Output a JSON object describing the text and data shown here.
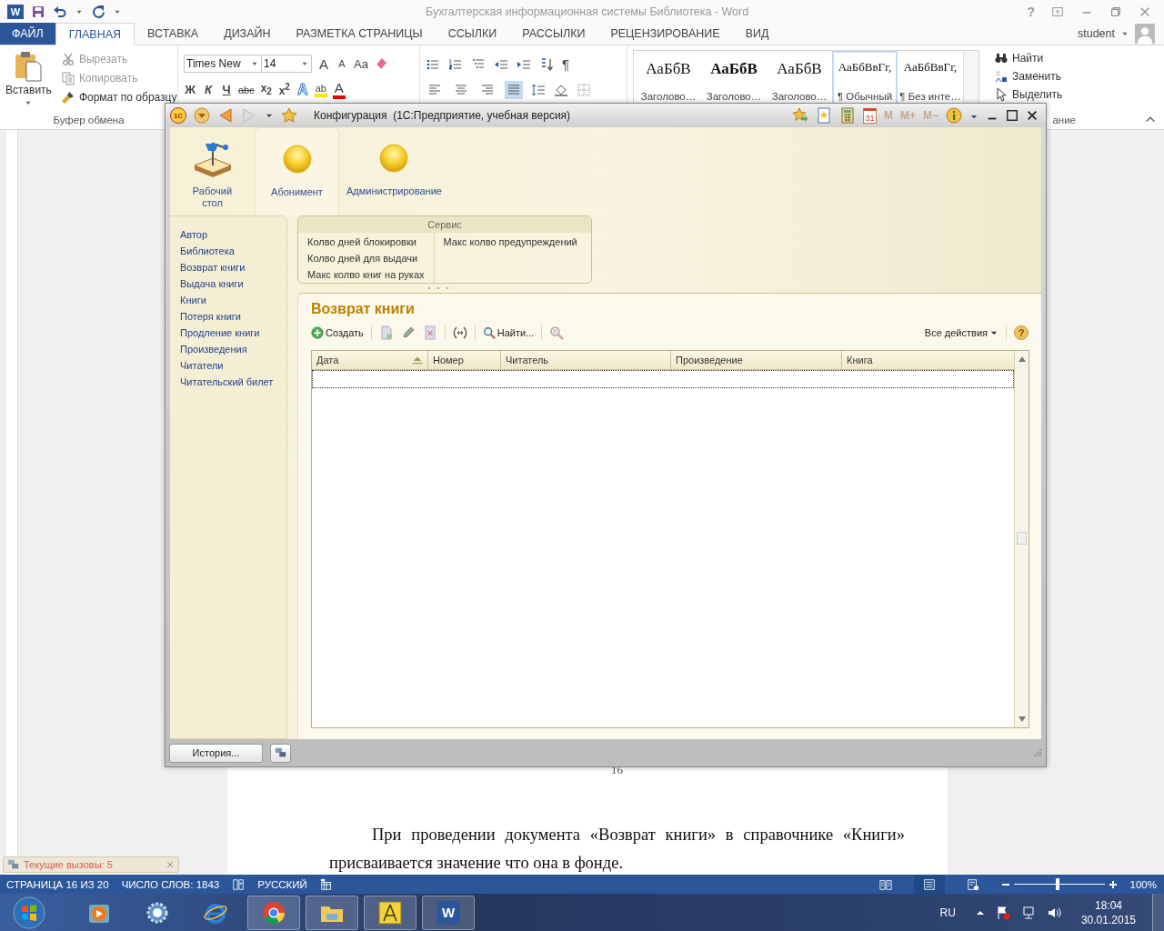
{
  "word": {
    "logo": "W",
    "title": "Бухгалтерская информационная системы Библиотека - Word",
    "help": "?",
    "tabs": [
      {
        "label": "ФАЙЛ",
        "kind": "file",
        "selected": false
      },
      {
        "label": "ГЛАВНАЯ",
        "kind": "tab",
        "selected": true
      },
      {
        "label": "ВСТАВКА",
        "kind": "tab",
        "selected": false
      },
      {
        "label": "ДИЗАЙН",
        "kind": "tab",
        "selected": false
      },
      {
        "label": "РАЗМЕТКА СТРАНИЦЫ",
        "kind": "tab",
        "selected": false
      },
      {
        "label": "ССЫЛКИ",
        "kind": "tab",
        "selected": false
      },
      {
        "label": "РАССЫЛКИ",
        "kind": "tab",
        "selected": false
      },
      {
        "label": "РЕЦЕНЗИРОВАНИЕ",
        "kind": "tab",
        "selected": false
      },
      {
        "label": "ВИД",
        "kind": "tab",
        "selected": false
      }
    ],
    "user": "student",
    "clipboard": {
      "paste": "Вставить",
      "label": "Буфер обмена",
      "items": [
        {
          "label": "Вырезать",
          "kind": "cut",
          "disabled": true
        },
        {
          "label": "Копировать",
          "kind": "copy",
          "disabled": true
        },
        {
          "label": "Формат по образцу",
          "kind": "brush",
          "disabled": false
        }
      ]
    },
    "font": {
      "name": "Times New",
      "size": "14",
      "grow": "A",
      "shrink": "A",
      "case": "Аа",
      "format": [
        {
          "kind": "bold",
          "label": "Ж"
        },
        {
          "kind": "italic",
          "label": "К"
        },
        {
          "kind": "underline",
          "label": "Ч"
        },
        {
          "kind": "strike",
          "label": "abc"
        },
        {
          "kind": "sub",
          "label": "x$_{2}$"
        },
        {
          "kind": "sup",
          "label": "x$^{2}$"
        }
      ],
      "effects": [
        {
          "kind": "effect",
          "label": "A"
        },
        {
          "kind": "highlight",
          "label": "ab"
        },
        {
          "kind": "color",
          "label": "A"
        }
      ]
    },
    "paragraph_group": {
      "pilcrow": "¶",
      "align": [
        {
          "kind": "left",
          "selected": false
        },
        {
          "kind": "center",
          "selected": false
        },
        {
          "kind": "right",
          "selected": false
        },
        {
          "kind": "justify",
          "selected": true
        }
      ]
    },
    "styles": [
      {
        "preview": "АаБбВ",
        "name": "Заголово…",
        "bold": false,
        "selected": false
      },
      {
        "preview": "АаБбВ",
        "name": "Заголово…",
        "bold": true,
        "selected": false
      },
      {
        "preview": "АаБбВ",
        "name": "Заголово…",
        "bold": false,
        "selected": false
      },
      {
        "preview": "АаБбВвГг,",
        "name": "¶ Обычный",
        "bold": false,
        "selected": true
      },
      {
        "preview": "АаБбВвГг,",
        "name": "¶ Без инте…",
        "bold": false,
        "selected": false
      }
    ],
    "editing": {
      "items": [
        {
          "label": "Найти",
          "kind": "find"
        },
        {
          "label": "Заменить",
          "kind": "replace"
        },
        {
          "label": "Выделить",
          "kind": "select"
        }
      ],
      "label": "ание"
    },
    "page_number": "16",
    "paragraph": "При проведении документа «Возврат книги» в справочнике «Книги» присваивается значение что она в фонде.",
    "status": {
      "page": "СТРАНИЦА 16 ИЗ 20",
      "words": "ЧИСЛО СЛОВ: 1843",
      "language": "РУССКИЙ",
      "zoom": "100%",
      "level": 0.48,
      "views": [
        {
          "kind": "read",
          "selected": false
        },
        {
          "kind": "print",
          "selected": true
        },
        {
          "kind": "web",
          "selected": false
        }
      ]
    }
  },
  "notification": {
    "text": "Текущие вызовы: 5"
  },
  "taskbar": {
    "word_letter": "W",
    "language": "RU",
    "time": "18:04",
    "date": "30.01.2015"
  },
  "onec": {
    "logo": "1С",
    "title": "Конфигурация  (1С:Предприятие, учебная версия)",
    "calendar_day": "31",
    "memory": [
      "M",
      "M+",
      "M−"
    ],
    "sections": [
      {
        "label": "Рабочий стол",
        "kind": "desk",
        "selected": false
      },
      {
        "label": "Абонимент",
        "kind": "ball",
        "selected": true
      },
      {
        "label": "Администрирование",
        "kind": "ball",
        "selected": false
      }
    ],
    "nav": [
      "Автор",
      "Библиотека",
      "Возврат книги",
      "Выдача книги",
      "Книги",
      "Потеря книги",
      "Продление книги",
      "Произведения",
      "Читатели",
      "Читательский билет"
    ],
    "service": {
      "title": "Сервис",
      "columns": [
        [
          "Колво дней блокировки",
          "Колво дней для выдачи",
          "Макс колво книг на руках"
        ],
        [
          "Макс колво предупреждений"
        ]
      ]
    },
    "form": {
      "title": "Возврат книги",
      "create": "Создать",
      "find": "Найти...",
      "all_actions": "Все действия",
      "help": "?",
      "columns": [
        {
          "label": "Дата",
          "sorted": true
        },
        {
          "label": "Номер",
          "sorted": false
        },
        {
          "label": "Читатель",
          "sorted": false
        },
        {
          "label": "Произведение",
          "sorted": false
        },
        {
          "label": "Книга",
          "sorted": false
        }
      ]
    },
    "history": "История..."
  }
}
